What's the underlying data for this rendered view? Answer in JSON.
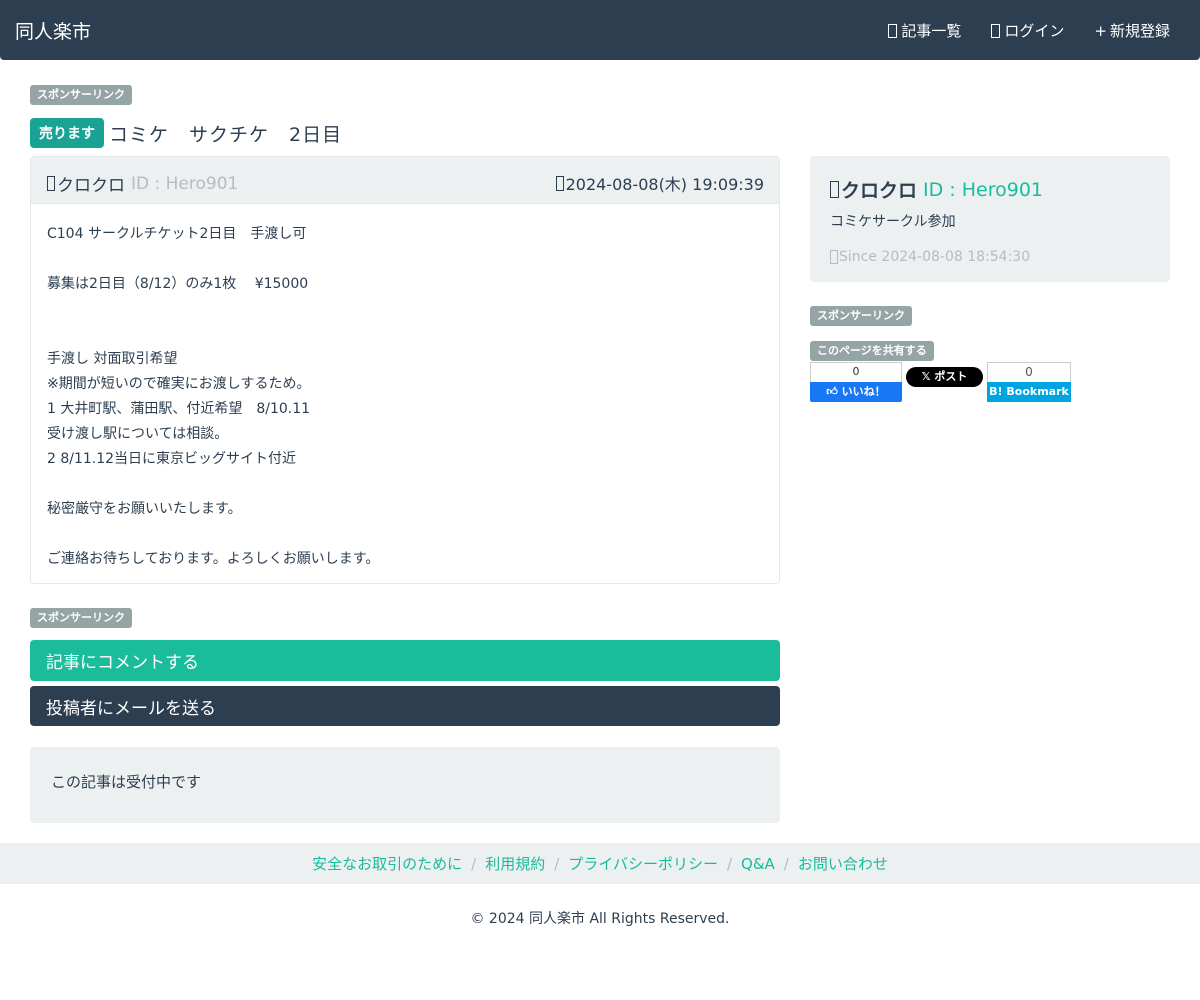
{
  "navbar": {
    "brand": "同人楽市",
    "links": [
      {
        "label": "記事一覧",
        "icon": "list-icon"
      },
      {
        "label": "ログイン",
        "icon": "login-icon"
      },
      {
        "label": "新規登録",
        "icon": "plus-icon",
        "prefix": "+"
      }
    ]
  },
  "sponsor_label": "スポンサーリンク",
  "share_label": "このページを共有する",
  "post": {
    "badge": "売ります",
    "title": "コミケ　サクチケ　2日目",
    "author": "クロクロ",
    "author_id": "ID : Hero901",
    "date": "2024-08-08(木) 19:09:39",
    "body": [
      "C104 サークルチケット2日目　手渡し可",
      "",
      "募集は2日目（8/12）のみ1枚　 ¥15000",
      "",
      "",
      "手渡し 対面取引希望",
      "※期間が短いので確実にお渡しするため。",
      "1 大井町駅、蒲田駅、付近希望　8/10.11",
      "受け渡し駅については相談。",
      "2 8/11.12当日に東京ビッグサイト付近",
      "",
      "秘密厳守をお願いいたします。",
      "",
      "ご連絡お待ちしております。よろしくお願いします。"
    ]
  },
  "buttons": {
    "comment": "記事にコメントする",
    "mail": "投稿者にメールを送る"
  },
  "status": "この記事は受付中です",
  "profile": {
    "name": "クロクロ",
    "id": "ID : Hero901",
    "description": "コミケサークル参加",
    "since": "Since 2024-08-08 18:54:30"
  },
  "share": {
    "facebook_count": "0",
    "facebook_label": "いいね！",
    "x_label": "ポスト",
    "hatena_count": "0",
    "hatena_label": "Bookmark"
  },
  "footer": {
    "links": [
      "安全なお取引のために",
      "利用規約",
      "プライバシーポリシー",
      "Q&A",
      "お問い合わせ"
    ],
    "copyright": "© 2024 同人楽市 All Rights Reserved."
  },
  "colors": {
    "navbar": "#2c3e50",
    "accent": "#1abc9c",
    "sell_badge": "#18a394",
    "panel": "#ecf0f1"
  }
}
